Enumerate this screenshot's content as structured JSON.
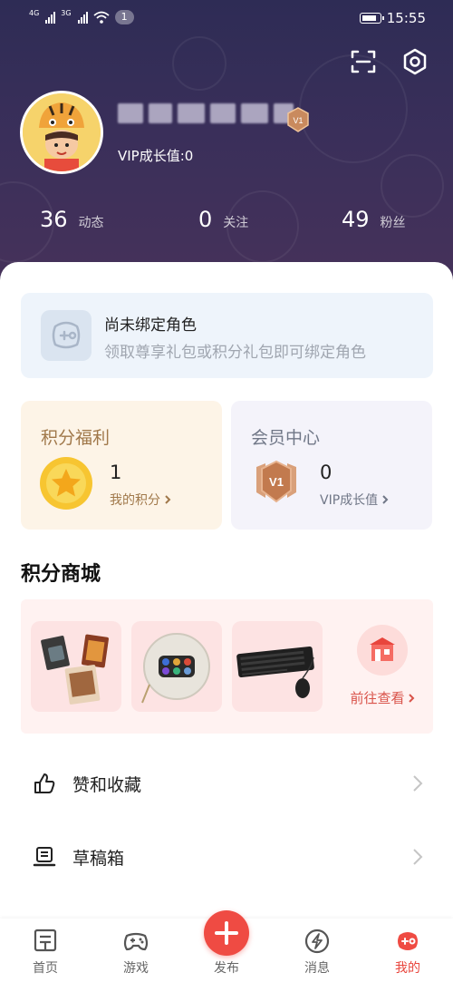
{
  "status_bar": {
    "network_1": "4G",
    "network_2": "3G",
    "notification_count": "1",
    "battery_level": 0.85,
    "time": "15:55"
  },
  "profile": {
    "vip_level": "V1",
    "vip_growth_text": "VIP成长值:0",
    "stats": [
      {
        "value": "36",
        "label": "动态"
      },
      {
        "value": "0",
        "label": "关注"
      },
      {
        "value": "49",
        "label": "粉丝"
      }
    ]
  },
  "bind_role": {
    "title": "尚未绑定角色",
    "subtitle": "领取尊享礼包或积分礼包即可绑定角色"
  },
  "benefits": {
    "points": {
      "title": "积分福利",
      "value": "1",
      "link": "我的积分"
    },
    "vip": {
      "title": "会员中心",
      "badge": "V1",
      "value": "0",
      "link": "VIP成长值"
    }
  },
  "mall": {
    "title": "积分商城",
    "goto_label": "前往查看"
  },
  "menu": [
    {
      "icon": "thumbs-up-icon",
      "label": "赞和收藏"
    },
    {
      "icon": "drafts-icon",
      "label": "草稿箱"
    }
  ],
  "nav": [
    {
      "icon": "home-icon",
      "label": "首页"
    },
    {
      "icon": "gamepad-icon",
      "label": "游戏"
    },
    {
      "icon": "plus-icon",
      "label": "发布"
    },
    {
      "icon": "lightning-icon",
      "label": "消息"
    },
    {
      "icon": "mine-icon",
      "label": "我的",
      "active": true
    }
  ],
  "colors": {
    "accent": "#ef4b43",
    "header_dark": "#2e2c55",
    "points_bg": "#fdf4e7",
    "vip_bg": "#f4f3fa"
  }
}
